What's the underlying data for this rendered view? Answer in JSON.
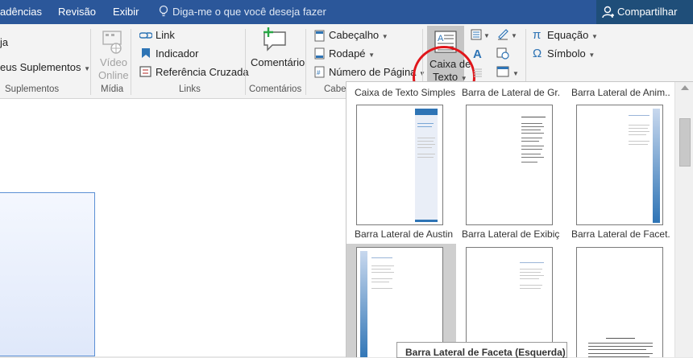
{
  "tabs": {
    "referencias": "adências",
    "revisao": "Revisão",
    "exibir": "Exibir"
  },
  "tellme": {
    "placeholder": "Diga-me o que você deseja fazer"
  },
  "share": {
    "label": "Compartilhar"
  },
  "ribbon": {
    "suplementos": {
      "loja": "ja",
      "meus": "eus Suplementos",
      "group": "Suplementos"
    },
    "midia": {
      "video_line1": "Vídeo",
      "video_line2": "Online",
      "group": "Mídia"
    },
    "links": {
      "link": "Link",
      "indicador": "Indicador",
      "referencia": "Referência Cruzada",
      "group": "Links"
    },
    "comentarios": {
      "comentario": "Comentário",
      "group": "Comentários"
    },
    "cabecalho": {
      "cabecalho": "Cabeçalho",
      "rodape": "Rodapé",
      "numero": "Número de Página",
      "group": "Cabe"
    },
    "texto": {
      "caixa_line1": "Caixa de",
      "caixa_line2": "Texto"
    },
    "simbolos": {
      "equacao": "Equação",
      "simbolo": "Símbolo"
    }
  },
  "gallery": {
    "row0": [
      "Caixa de Texto Simples",
      "Barra de Lateral de Gr...",
      "Barra Lateral de Anim..."
    ],
    "row1": [
      "Barra Lateral de Austin",
      "Barra Lateral de Exibiç...",
      "Barra Lateral de Facet..."
    ]
  },
  "tooltip": "Barra Lateral de Faceta (Esquerda)",
  "colors": {
    "title_bar": "#2b579a",
    "highlight_circle": "#e0161b",
    "accent": "#2e74b5"
  }
}
